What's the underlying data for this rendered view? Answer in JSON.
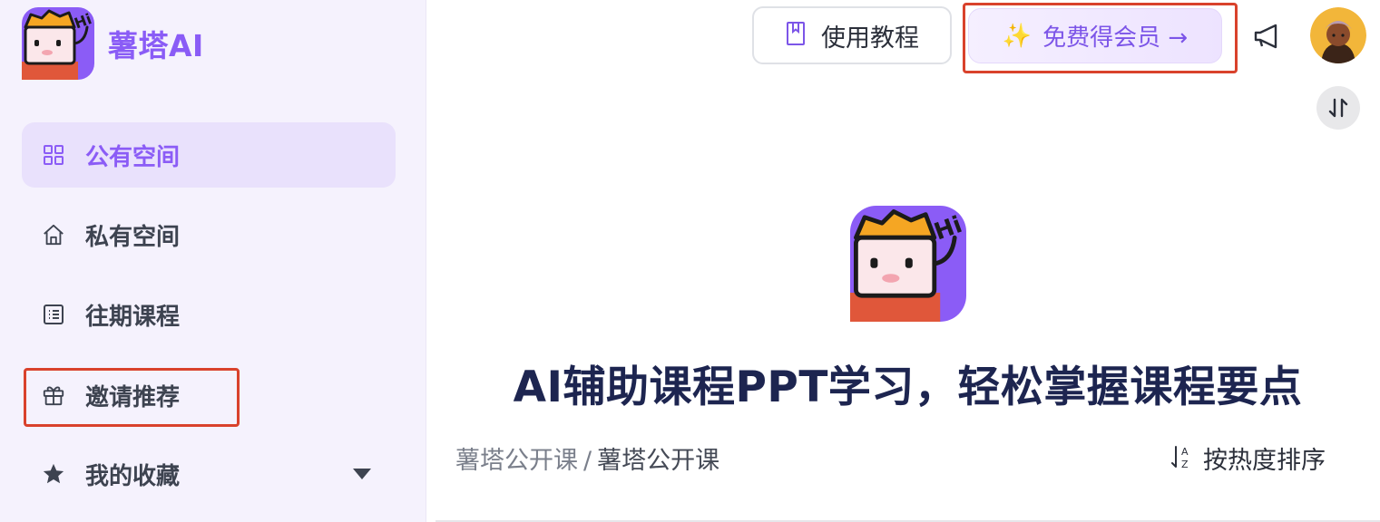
{
  "brand": {
    "name": "薯塔AI",
    "accent": "#8a5cf6"
  },
  "sidebar": {
    "items": [
      {
        "label": "公有空间",
        "icon": "grid-icon",
        "active": true
      },
      {
        "label": "私有空间",
        "icon": "home-icon"
      },
      {
        "label": "往期课程",
        "icon": "list-icon"
      },
      {
        "label": "邀请推荐",
        "icon": "gift-icon",
        "highlighted": true
      },
      {
        "label": "我的收藏",
        "icon": "star-icon",
        "expandable": true
      }
    ]
  },
  "header": {
    "tutorial_label": "使用教程",
    "member_label": "免费得会员 →",
    "member_icon": "sparkle-icon"
  },
  "main": {
    "title": "AI辅助课程PPT学习，轻松掌握课程要点",
    "breadcrumb": [
      "薯塔公开课",
      "薯塔公开课"
    ],
    "breadcrumb_separator": "/",
    "sort_label": "按热度排序"
  },
  "colors": {
    "highlight": "#d9422c",
    "title": "#1d2550",
    "sidebar_bg": "#f5f2fd"
  }
}
